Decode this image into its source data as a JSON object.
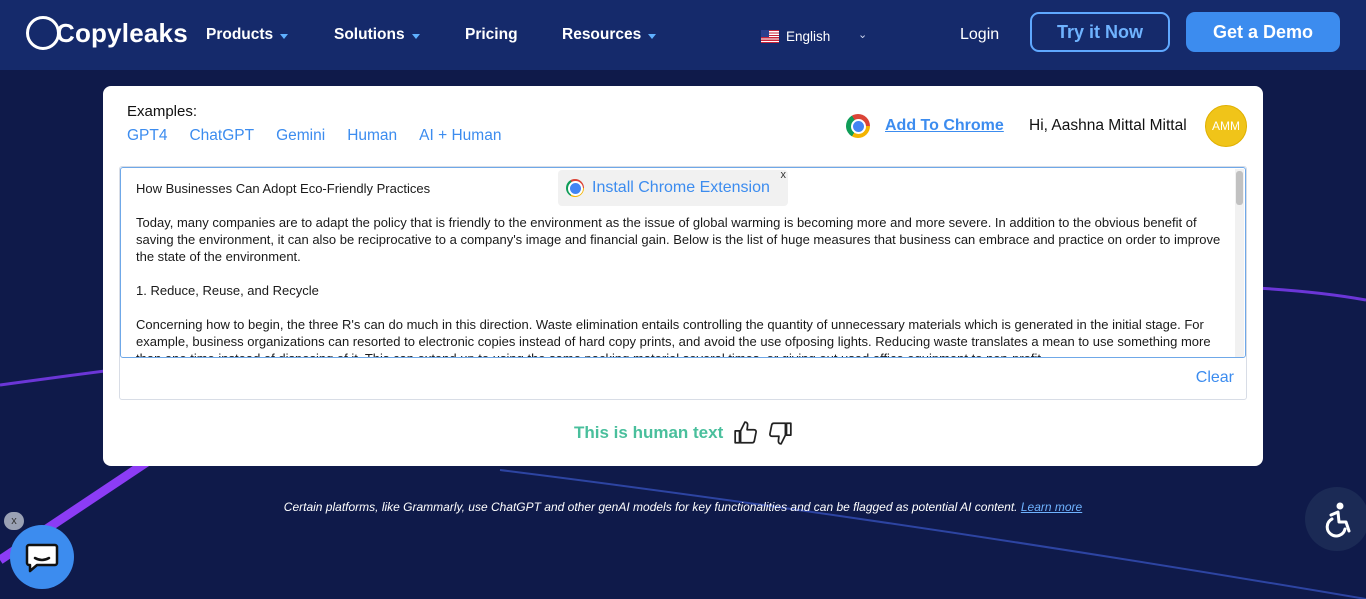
{
  "header": {
    "logo_text": "Copyleaks",
    "nav": [
      {
        "label": "Products",
        "has_dropdown": true
      },
      {
        "label": "Solutions",
        "has_dropdown": true
      },
      {
        "label": "Pricing",
        "has_dropdown": false
      },
      {
        "label": "Resources",
        "has_dropdown": true
      }
    ],
    "language": "English",
    "login_label": "Login",
    "try_label": "Try it Now",
    "demo_label": "Get a Demo"
  },
  "card": {
    "examples_label": "Examples:",
    "examples": [
      "GPT4",
      "ChatGPT",
      "Gemini",
      "Human",
      "AI + Human"
    ],
    "add_to_chrome": "Add To Chrome",
    "greeting": "Hi, Aashna Mittal Mittal",
    "avatar_initials": "AMM",
    "install_popup": "Install Chrome Extension",
    "install_close": "x",
    "text_paragraphs": [
      "How Businesses Can Adopt Eco-Friendly Practices",
      "Today, many companies are to adapt the policy that is friendly to the environment as the issue of global warming is becoming more and more severe. In addition to the obvious benefit of saving the environment, it can also be reciprocative to a company's image and financial gain. Below is the list of huge measures that business can embrace and practice on order to improve the state of the environment.",
      "1. Reduce, Reuse, and Recycle",
      "Concerning how to begin, the three R's can do much in this direction. Waste elimination entails controlling the quantity of unnecessary materials which is generated in the initial stage. For example, business organizations can resorted to electronic copies instead of hard copy prints, and avoid the use ofposing lights. Reducing waste translates a mean to use something more than one time instead of disposing of it. This can extend up to using the same packing material several times, or giving out used office equipment to non-profit"
    ],
    "clear_label": "Clear",
    "result_text": "This is human text"
  },
  "notice": {
    "text": "Certain platforms, like Grammarly, use ChatGPT and other genAI models for key functionalities and can be flagged as potential AI content.",
    "link": "Learn more"
  },
  "chat_close": "x",
  "colors": {
    "nav_bg": "#152a6b",
    "page_bg": "#0f1a4a",
    "accent": "#3c8cef",
    "result_green": "#49bf9c",
    "avatar": "#f0c419"
  }
}
